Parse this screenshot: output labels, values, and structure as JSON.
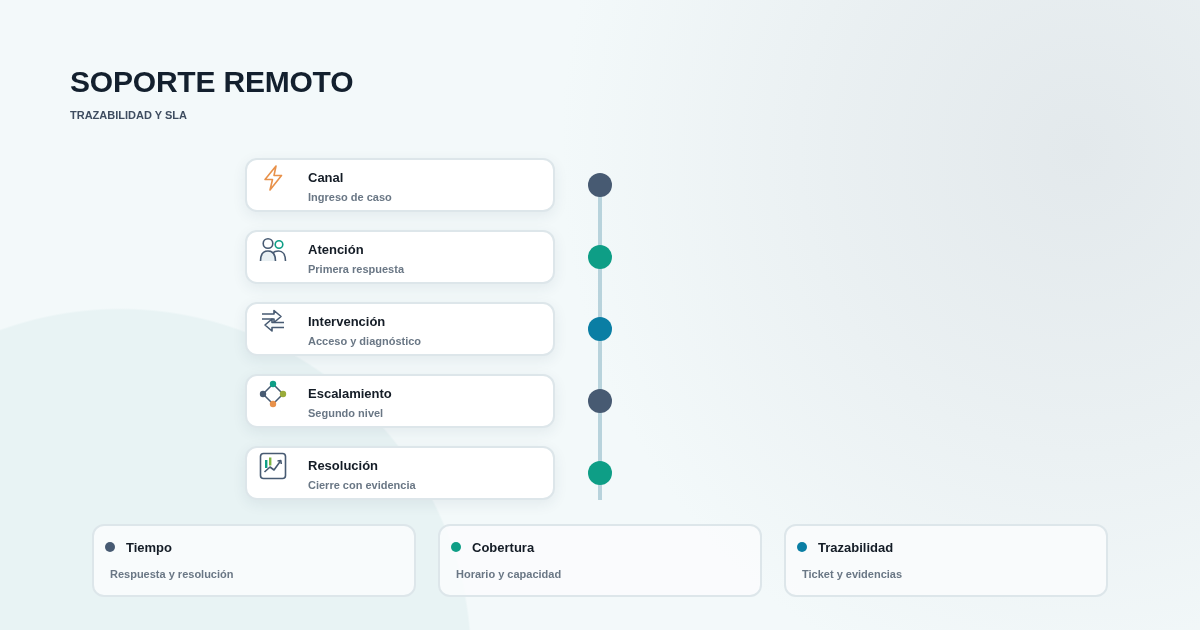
{
  "header": {
    "title": "SOPORTE REMOTO",
    "subtitle": "TRAZABILIDAD Y SLA"
  },
  "steps": [
    {
      "title": "Canal",
      "subtitle": "Ingreso de caso",
      "color": "#475a72"
    },
    {
      "title": "Atención",
      "subtitle": "Primera respuesta",
      "color": "#0e9e86"
    },
    {
      "title": "Intervención",
      "subtitle": "Acceso y diagnóstico",
      "color": "#0a7ea4"
    },
    {
      "title": "Escalamiento",
      "subtitle": "Segundo nivel",
      "color": "#475a72"
    },
    {
      "title": "Resolución",
      "subtitle": "Cierre con evidencia",
      "color": "#0e9e86"
    }
  ],
  "highlights": [
    {
      "title": "Tiempo",
      "subtitle": "Respuesta y resolución",
      "color": "#475a72"
    },
    {
      "title": "Cobertura",
      "subtitle": "Horario y capacidad",
      "color": "#0e9e86"
    },
    {
      "title": "Trazabilidad",
      "subtitle": "Ticket y evidencias",
      "color": "#0a7ea4"
    }
  ]
}
